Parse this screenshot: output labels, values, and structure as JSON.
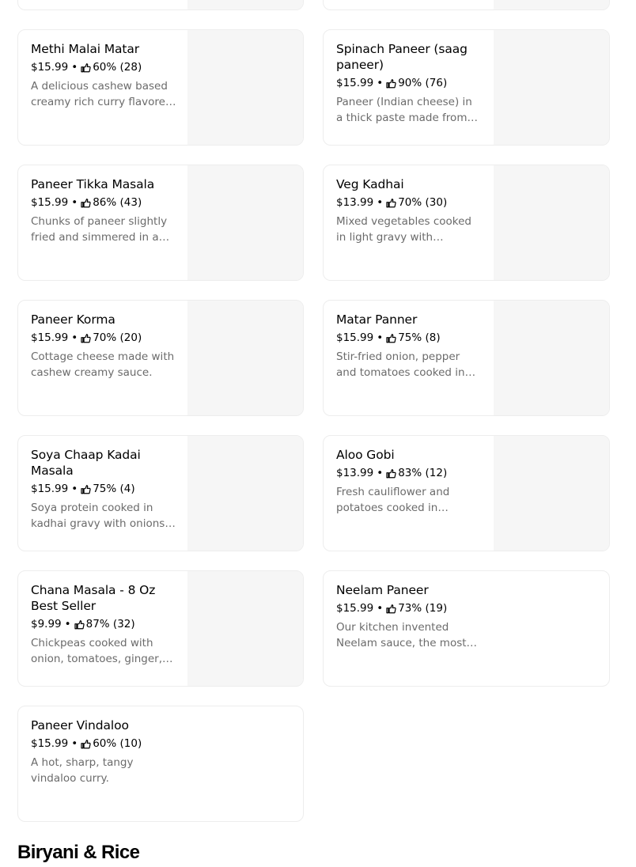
{
  "colors": {
    "text": "#000000",
    "muted": "#6b6b6b",
    "image_placeholder": "#f6f6f6",
    "border": "#ededed"
  },
  "icons": {
    "rating": "thumbs-up-icon"
  },
  "meta_separator": "•",
  "menu_items": [
    {
      "name": "Methi Malai Matar",
      "price": "$15.99",
      "rating": "60% (28)",
      "description": "A delicious cashew based creamy rich curry flavored with fenugreek leaves."
    },
    {
      "name": "Spinach Paneer (saag paneer)",
      "price": "$15.99",
      "rating": "90% (76)",
      "description": "Paneer (Indian cheese) in a thick paste made from pureed spinach."
    },
    {
      "name": "Paneer Tikka Masala",
      "price": "$15.99",
      "rating": "86% (43)",
      "description": "Chunks of paneer slightly fried and simmered in a rich tomato gravy."
    },
    {
      "name": "Veg Kadhai",
      "price": "$13.99",
      "rating": "70% (30)",
      "description": "Mixed vegetables cooked in light gravy with traditionally."
    },
    {
      "name": "Paneer Korma",
      "price": "$15.99",
      "rating": "70% (20)",
      "description": "Cottage cheese made with cashew creamy sauce."
    },
    {
      "name": "Matar Panner",
      "price": "$15.99",
      "rating": "75% (8)",
      "description": "Stir-fried onion, pepper and tomatoes cooked in tomato gravy with peas."
    },
    {
      "name": "Soya Chaap Kadai Masala",
      "price": "$15.99",
      "rating": "75% (4)",
      "description": "Soya protein cooked in kadhai gravy with onions & peppers."
    },
    {
      "name": "Aloo Gobi",
      "price": "$13.99",
      "rating": "83% (12)",
      "description": "Fresh cauliflower and potatoes cooked in traditional spices."
    },
    {
      "name": "Chana Masala - 8 Oz Best Seller",
      "price": "$9.99",
      "rating": "87% (32)",
      "description": "Chickpeas cooked with onion, tomatoes, ginger, garlic and spices."
    },
    {
      "name": "Neelam Paneer",
      "price": "$15.99",
      "rating": "73% (19)",
      "description": "Our kitchen invented Neelam sauce, the most popular paneer dish."
    },
    {
      "name": "Paneer Vindaloo",
      "price": "$15.99",
      "rating": "60% (10)",
      "description": "A hot, sharp, tangy vindaloo curry."
    }
  ],
  "next_section": {
    "title": "Biryani & Rice"
  }
}
